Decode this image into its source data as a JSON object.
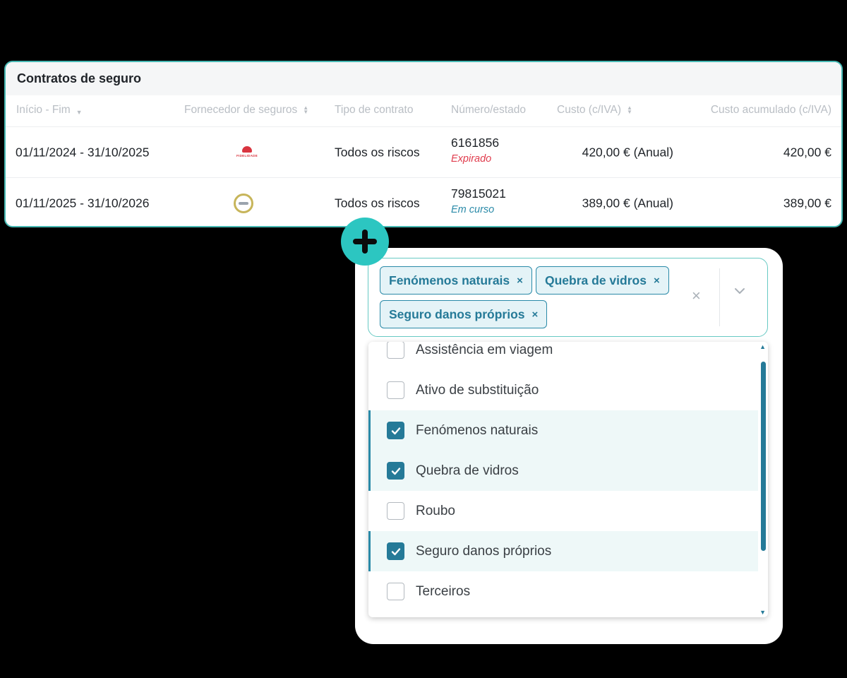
{
  "contracts": {
    "title": "Contratos de seguro",
    "columns": {
      "dates": "Início - Fim",
      "provider": "Fornecedor de seguros",
      "type": "Tipo de contrato",
      "number": "Número/estado",
      "cost": "Custo (c/IVA)",
      "accumulated": "Custo acumulado (c/IVA)"
    },
    "rows": [
      {
        "dates": "01/11/2024 - 31/10/2025",
        "provider_logo": "fidelidade-logo",
        "provider_logo_text": "FIDELIDADE",
        "type": "Todos os riscos",
        "number": "6161856",
        "status": "Expirado",
        "cost": "420,00 € (Anual)",
        "accumulated": "420,00 €"
      },
      {
        "dates": "01/11/2025 - 31/10/2026",
        "provider_logo": "round-seal-logo",
        "type": "Todos os riscos",
        "number": "79815021",
        "status": "Em curso",
        "cost": "389,00 € (Anual)",
        "accumulated": "389,00 €"
      }
    ]
  },
  "coverage_select": {
    "chips": [
      {
        "label": "Fenómenos naturais",
        "remove": "×"
      },
      {
        "label": "Quebra de vidros",
        "remove": "×"
      },
      {
        "label": "Seguro danos próprios",
        "remove": "×"
      }
    ],
    "clear_all": "×",
    "options": [
      {
        "label": "Assistência em viagem",
        "checked": false
      },
      {
        "label": "Ativo de substituição",
        "checked": false
      },
      {
        "label": "Fenómenos naturais",
        "checked": true
      },
      {
        "label": "Quebra de vidros",
        "checked": true
      },
      {
        "label": "Roubo",
        "checked": false
      },
      {
        "label": "Seguro danos próprios",
        "checked": true
      },
      {
        "label": "Terceiros",
        "checked": false
      }
    ]
  },
  "colors": {
    "accent": "#2a8aa8",
    "badge": "#2cc6c1",
    "expired": "#e03c4d",
    "card_border": "#47b9b4"
  }
}
